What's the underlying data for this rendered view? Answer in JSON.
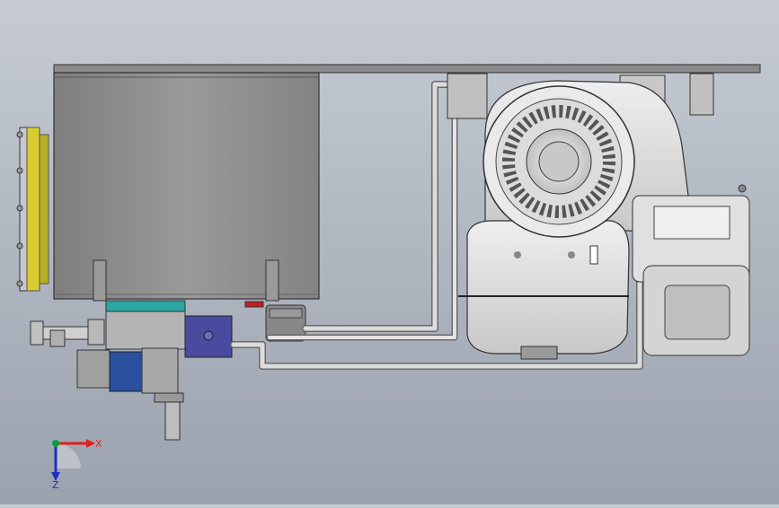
{
  "viewport": {
    "background_top": "#c6cbd3",
    "background_bottom": "#9aa2ae"
  },
  "triad": {
    "x_label": "X",
    "z_label": "Z",
    "x_color": "#e02020",
    "z_color": "#2030c0",
    "origin_color": "#10a040"
  },
  "colors": {
    "tank": "#8e8e8e",
    "plate": "#8a8a8a",
    "flange": "#d8cc30",
    "manifold_cap": "#2aa7a0",
    "valve_block": "#4a4aa0",
    "solenoid": "#2a50a0",
    "indicator": "#c02020"
  }
}
